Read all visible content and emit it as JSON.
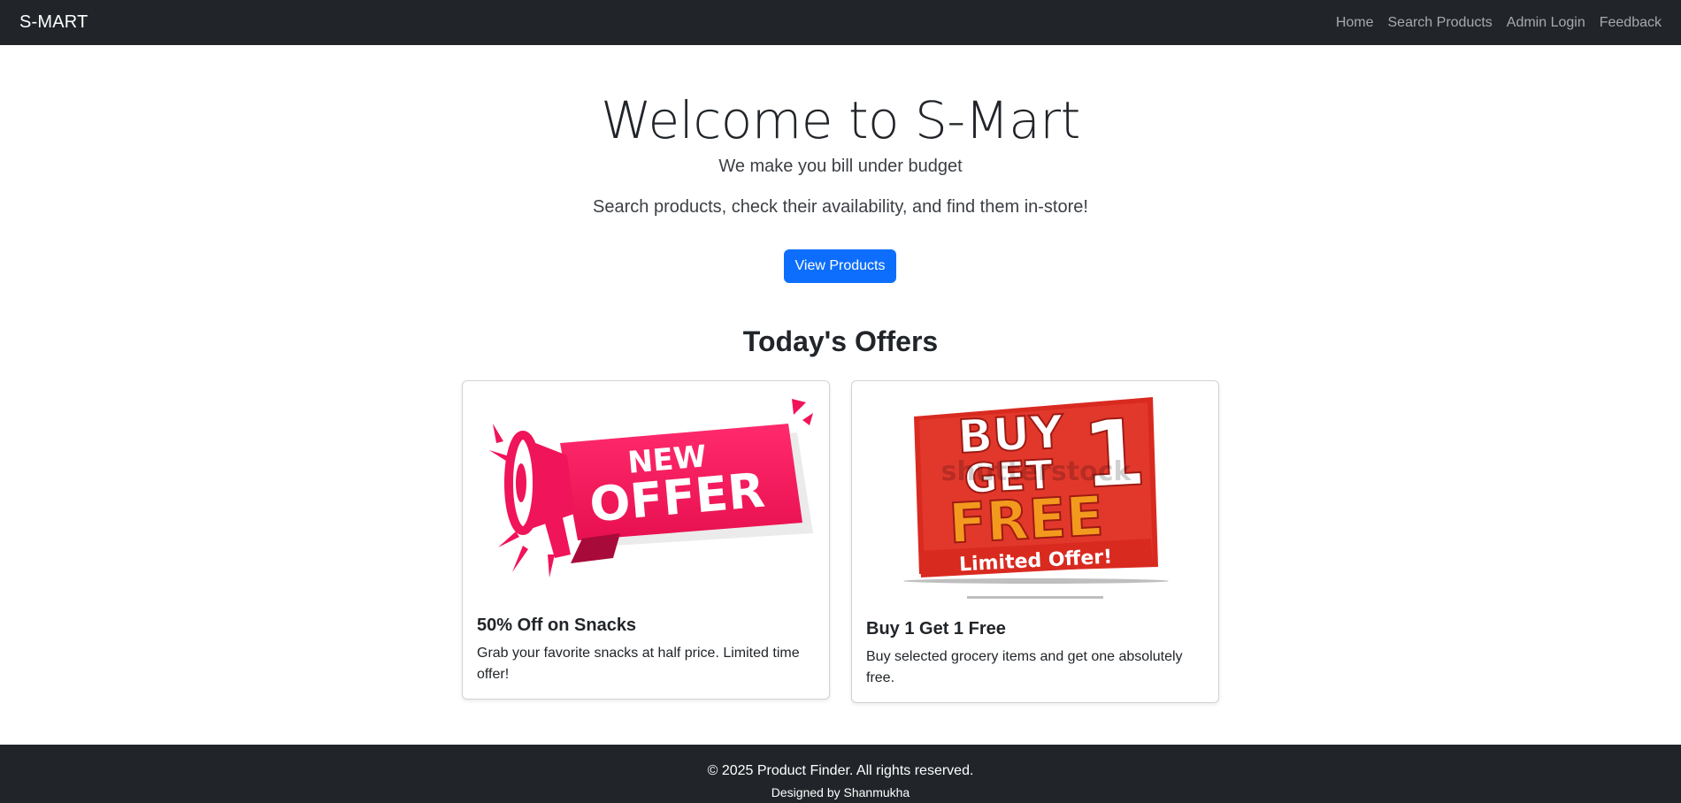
{
  "navbar": {
    "brand": "S-MART",
    "links": [
      "Home",
      "Search Products",
      "Admin Login",
      "Feedback"
    ]
  },
  "hero": {
    "title": "Welcome to S-Mart",
    "tagline": "We make you bill under budget",
    "lead": "Search products, check their availability, and find them in-store!",
    "button": "View Products"
  },
  "offers": {
    "heading": "Today's Offers",
    "cards": [
      {
        "image_text_1": "NEW",
        "image_text_2": "OFFER",
        "title": "50% Off on Snacks",
        "text": "Grab your favorite snacks at half price. Limited time offer!"
      },
      {
        "image_text_1": "BUY",
        "image_text_2": "GET",
        "image_text_3": "1",
        "image_text_4": "FREE",
        "image_text_5": "Limited Offer!",
        "image_watermark": "shutterstock",
        "title": "Buy 1 Get 1 Free",
        "text": "Buy selected grocery items and get one absolutely free."
      }
    ]
  },
  "footer": {
    "copyright": "© 2025 Product Finder. All rights reserved.",
    "credit": "Designed by Shanmukha"
  },
  "colors": {
    "navbar_bg": "#212529",
    "primary": "#0d6efd",
    "offer_red": "#f0145a",
    "bogo_red": "#d92a20",
    "bogo_orange": "#f39a1e"
  }
}
